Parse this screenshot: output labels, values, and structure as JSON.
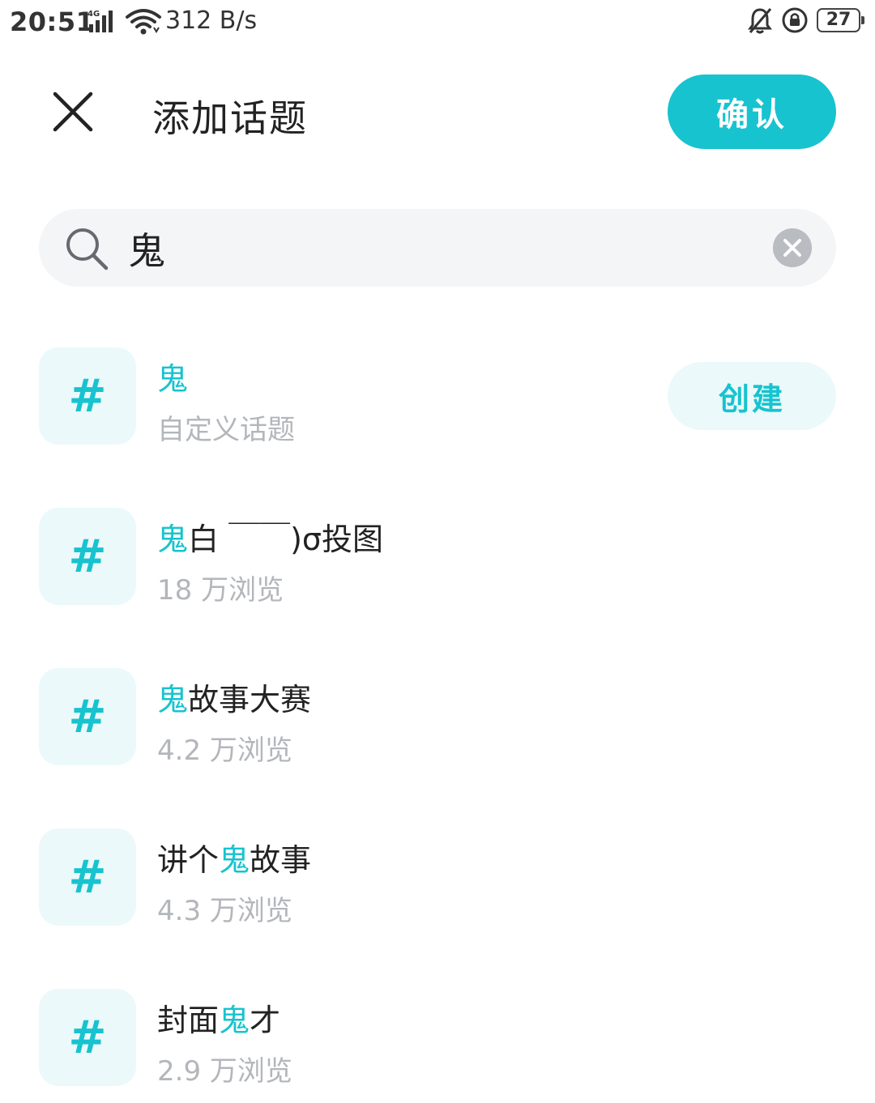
{
  "status_bar": {
    "time": "20:51",
    "network_type": "4G",
    "speed": "312 B/s",
    "battery": "27",
    "icons": [
      "signal-icon",
      "wifi-icon",
      "mute-icon",
      "rotation-lock-icon",
      "battery-icon"
    ]
  },
  "header": {
    "title": "添加话题",
    "confirm_label": "确认",
    "close_icon": "close-icon"
  },
  "search": {
    "value": "鬼",
    "search_icon": "search-icon",
    "clear_icon": "clear-icon"
  },
  "colors": {
    "accent": "#17c3cf",
    "accent_light": "#ebf9fa",
    "text_primary": "#222222",
    "text_secondary": "#b3b6ba",
    "search_bg": "#f4f5f7"
  },
  "topics": [
    {
      "hash": "#",
      "pre": "",
      "highlight": "鬼",
      "post": "",
      "meta": "自定义话题",
      "action_label": "创建"
    },
    {
      "hash": "#",
      "pre": "",
      "highlight": "鬼",
      "post": "白 ￣￣)σ投图",
      "meta": "18 万浏览"
    },
    {
      "hash": "#",
      "pre": "",
      "highlight": "鬼",
      "post": "故事大赛",
      "meta": "4.2 万浏览"
    },
    {
      "hash": "#",
      "pre": "讲个",
      "highlight": "鬼",
      "post": "故事",
      "meta": "4.3 万浏览"
    },
    {
      "hash": "#",
      "pre": "封面",
      "highlight": "鬼",
      "post": "才",
      "meta": "2.9 万浏览"
    }
  ]
}
